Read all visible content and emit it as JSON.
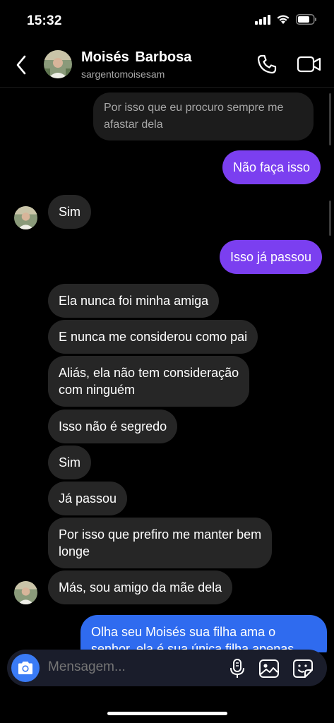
{
  "status": {
    "time": "15:32"
  },
  "contact": {
    "name": "Moisés  Barbosa",
    "username": "sargentomoisesam"
  },
  "messages": {
    "m1": {
      "line1": "Por isso que eu procuro sempre me",
      "line2": "afastar dela"
    },
    "m2": "Não faça isso",
    "m3": "Sim",
    "m4": "Isso já passou",
    "m5": "Ela nunca foi minha amiga",
    "m6": "E nunca me considerou como pai",
    "m7": {
      "line1": "Aliás, ela não tem consideração",
      "line2": "com ninguém"
    },
    "m8": "Isso não é segredo",
    "m9": "Sim",
    "m10": "Já passou",
    "m11": {
      "line1": "Por isso que prefiro me manter bem",
      "line2": "longe"
    },
    "m12": "Más, sou amigo da mãe dela",
    "m13": {
      "line1": "Olha seu Moisés sua filha ama o",
      "line2": "senhor, ela é sua única filha apenas"
    }
  },
  "composer": {
    "placeholder": "Mensagem..."
  },
  "colors": {
    "outgoing": "#7b3ff0",
    "incoming": "#262626",
    "highlight": "#2f6bef",
    "camera": "#3a7bf6"
  },
  "icons": [
    "back-icon",
    "phone-icon",
    "video-camera-icon",
    "camera-icon",
    "microphone-icon",
    "image-icon",
    "sticker-icon"
  ]
}
